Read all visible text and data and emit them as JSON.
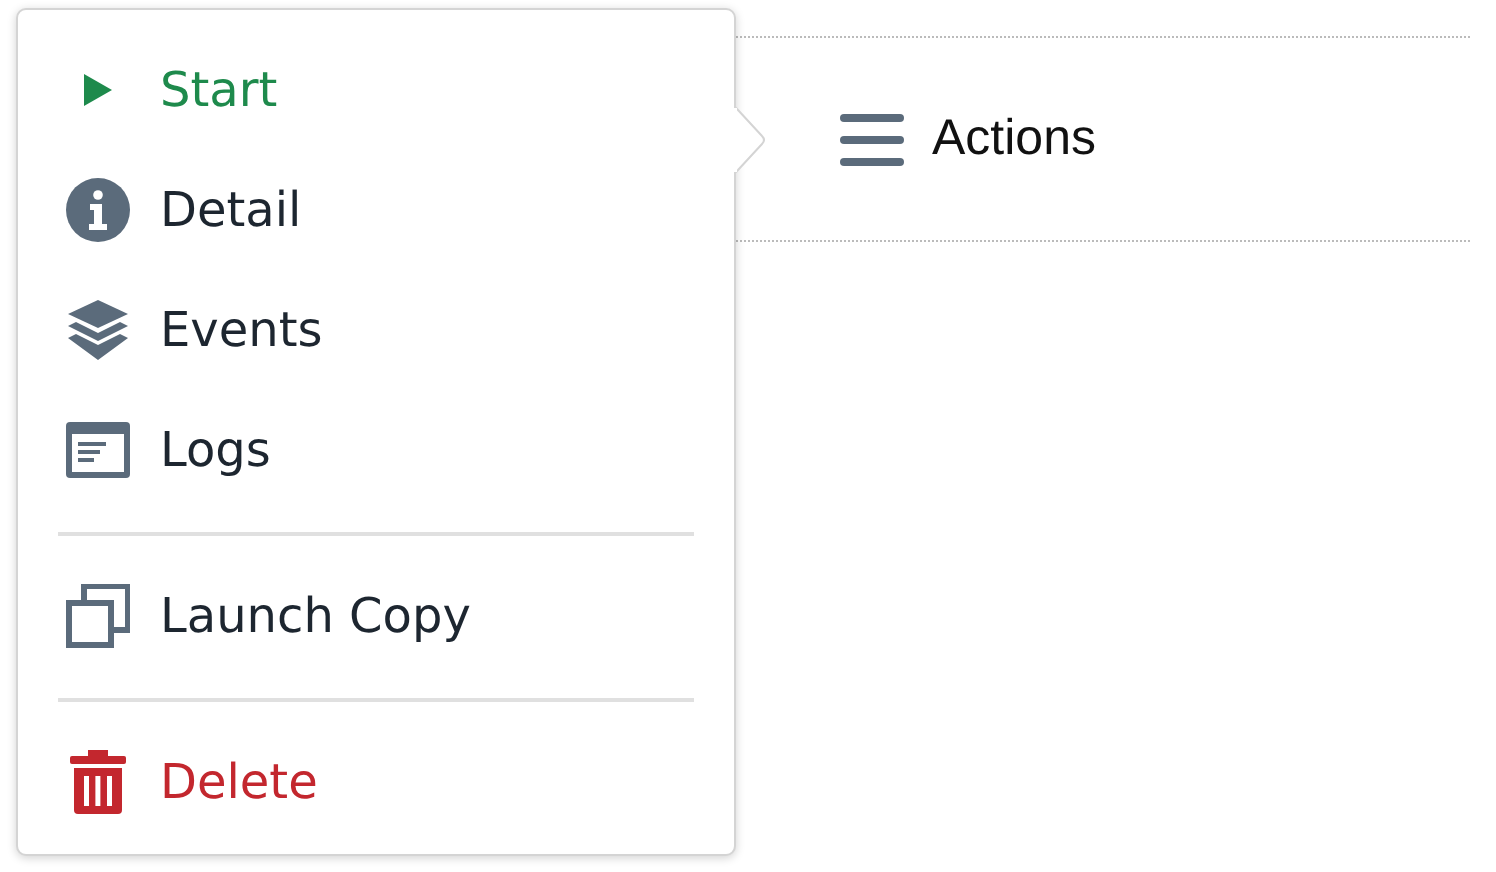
{
  "menu": {
    "groups": [
      {
        "items": [
          {
            "kind": "start",
            "label": "Start",
            "color": "#1e8a4c"
          },
          {
            "kind": "detail",
            "label": "Detail",
            "color": "#1d2630"
          },
          {
            "kind": "events",
            "label": "Events",
            "color": "#1d2630"
          },
          {
            "kind": "logs",
            "label": "Logs",
            "color": "#1d2630"
          }
        ]
      },
      {
        "items": [
          {
            "kind": "copy",
            "label": "Launch Copy",
            "color": "#1d2630"
          }
        ]
      },
      {
        "items": [
          {
            "kind": "delete",
            "label": "Delete",
            "color": "#c3272e"
          }
        ]
      }
    ]
  },
  "actions_button": {
    "label": "Actions"
  }
}
